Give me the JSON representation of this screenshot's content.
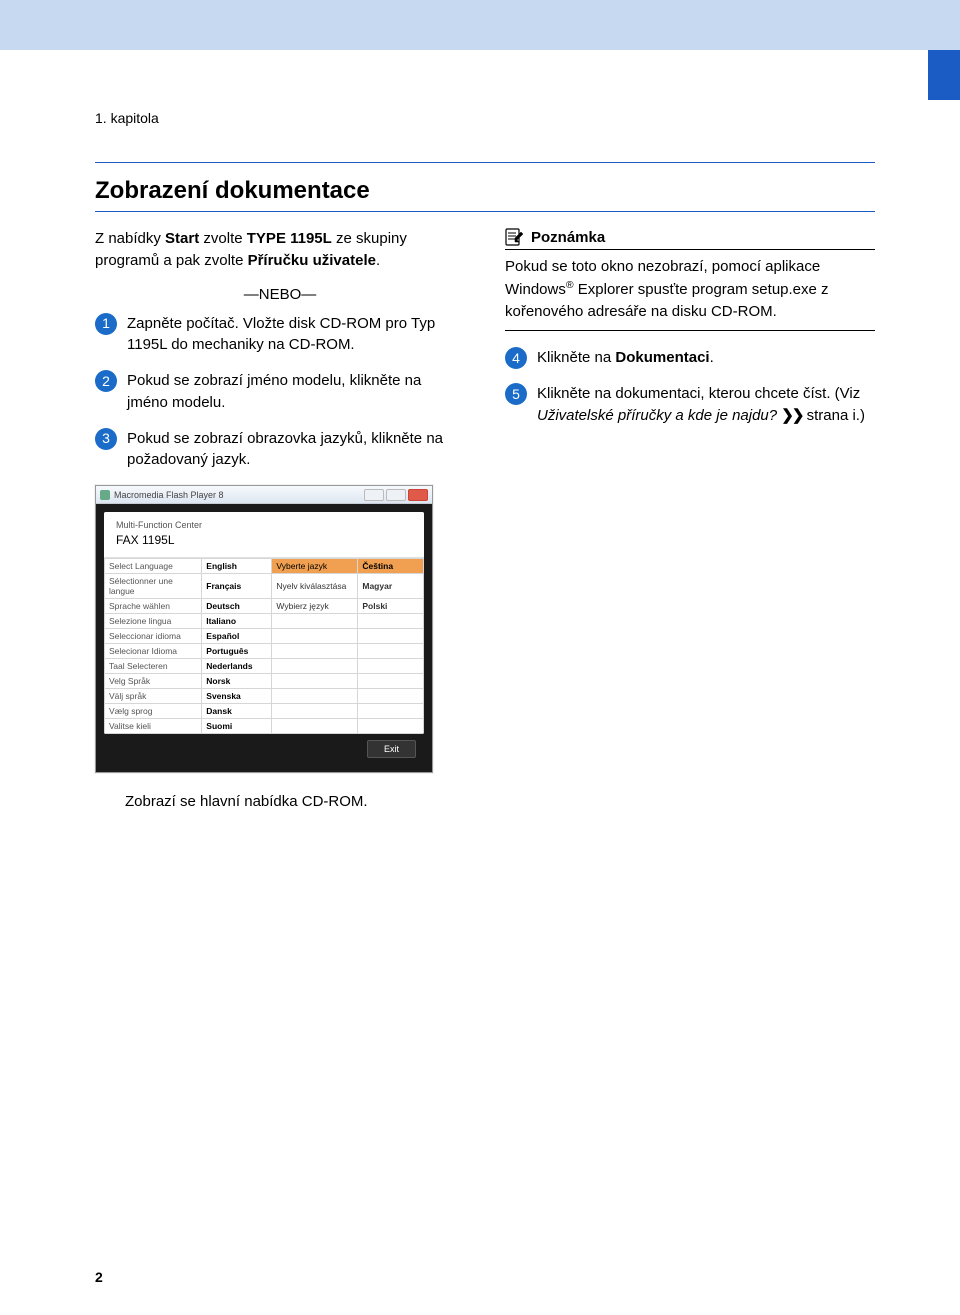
{
  "chapter": "1. kapitola",
  "heading": "Zobrazení dokumentace",
  "intro_parts": {
    "a": "Z nabídky ",
    "b": "Start",
    "c": " zvolte ",
    "d": "TYPE 1195L",
    "e": " ze skupiny programů a pak zvolte ",
    "f": "Příručku uživatele",
    "g": "."
  },
  "nebo": "—NEBO—",
  "steps_left": {
    "s1": "Zapněte počítač. Vložte disk CD-ROM pro Typ 1195L do mechaniky na CD-ROM.",
    "s2": "Pokud se zobrazí jméno modelu, klikněte na jméno modelu.",
    "s3": "Pokud se zobrazí obrazovka jazyků, klikněte na požadovaný jazyk."
  },
  "after_shot": "Zobrazí se hlavní nabídka CD-ROM.",
  "note": {
    "title": "Poznámka",
    "body_a": "Pokud se toto okno nezobrazí, pomocí aplikace Windows",
    "body_b": " Explorer spusťte program setup.exe z kořenového adresáře na disku CD-ROM."
  },
  "steps_right": {
    "s4_a": "Klikněte na ",
    "s4_b": "Dokumentaci",
    "s4_c": ".",
    "s5_a": "Klikněte na dokumentaci, kterou chcete číst. (Viz ",
    "s5_b": "Uživatelské příručky a kde je najdu?",
    "s5_c": " strana i.)"
  },
  "bullets": {
    "b1": "1",
    "b2": "2",
    "b3": "3",
    "b4": "4",
    "b5": "5"
  },
  "flash": {
    "title": "Macromedia Flash Player 8",
    "mfc": "Multi-Function Center",
    "model": "FAX 1195L",
    "exit": "Exit",
    "rows": [
      {
        "l1": "Select Language",
        "v1": "English",
        "l2": "Vyberte jazyk",
        "v2": "Čeština",
        "sel": true
      },
      {
        "l1": "Sélectionner une langue",
        "v1": "Français",
        "l2": "Nyelv kiválasztása",
        "v2": "Magyar"
      },
      {
        "l1": "Sprache wählen",
        "v1": "Deutsch",
        "l2": "Wybierz język",
        "v2": "Polski"
      },
      {
        "l1": "Selezione lingua",
        "v1": "Italiano",
        "l2": "",
        "v2": ""
      },
      {
        "l1": "Seleccionar idioma",
        "v1": "Español",
        "l2": "",
        "v2": ""
      },
      {
        "l1": "Selecionar Idioma",
        "v1": "Português",
        "l2": "",
        "v2": ""
      },
      {
        "l1": "Taal Selecteren",
        "v1": "Nederlands",
        "l2": "",
        "v2": ""
      },
      {
        "l1": "Velg Språk",
        "v1": "Norsk",
        "l2": "",
        "v2": ""
      },
      {
        "l1": "Välj språk",
        "v1": "Svenska",
        "l2": "",
        "v2": ""
      },
      {
        "l1": "Vælg sprog",
        "v1": "Dansk",
        "l2": "",
        "v2": ""
      },
      {
        "l1": "Valitse kieli",
        "v1": "Suomi",
        "l2": "",
        "v2": ""
      }
    ]
  },
  "arrows": "❯❯",
  "reg": "®",
  "page_num": "2"
}
